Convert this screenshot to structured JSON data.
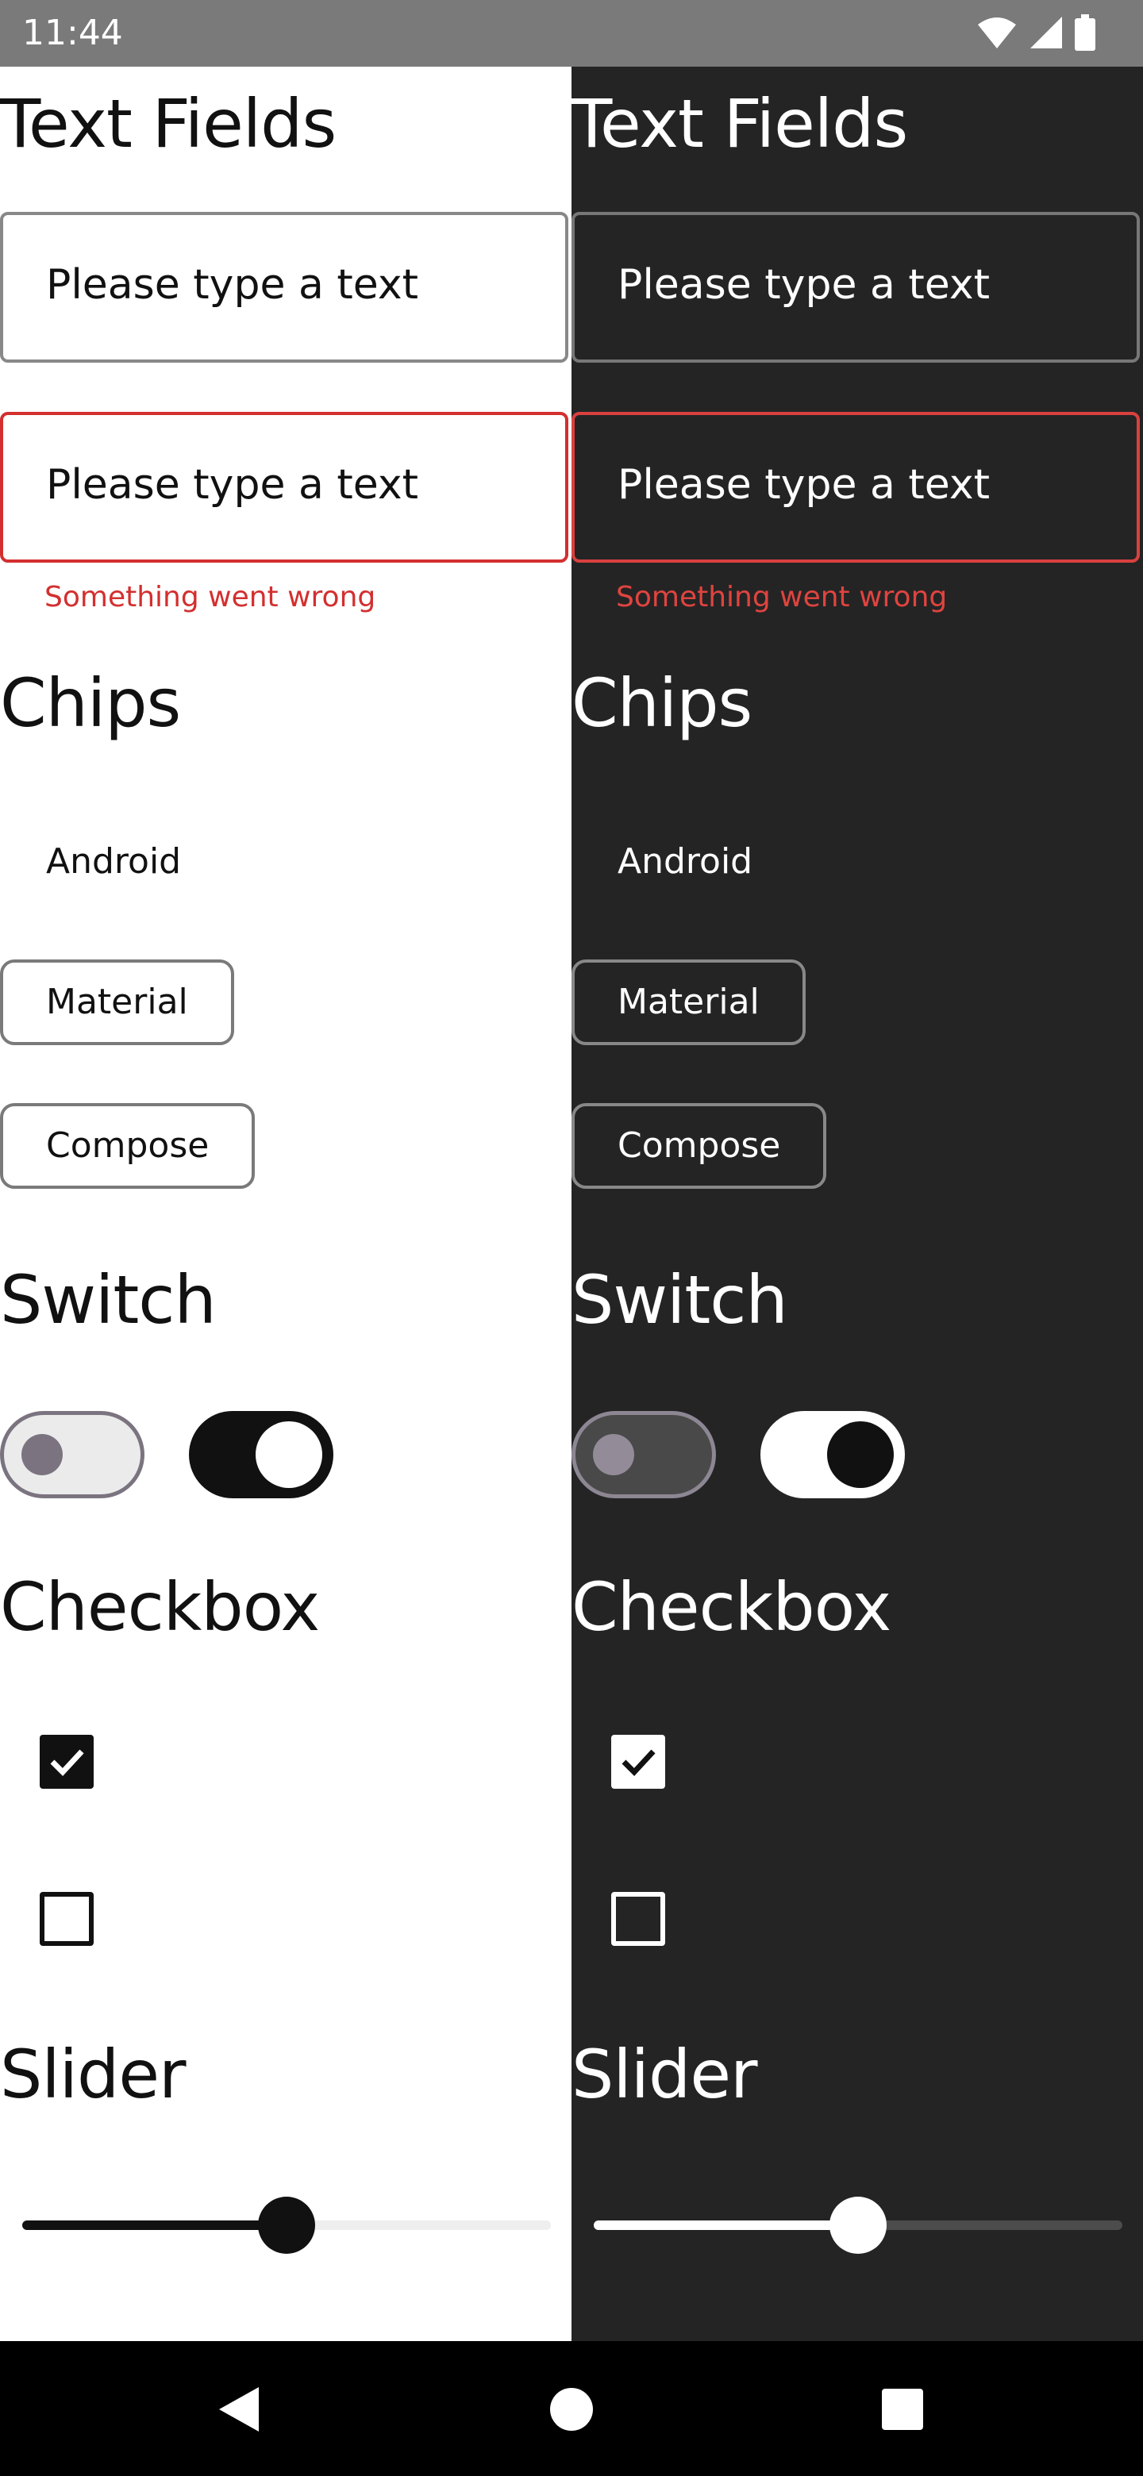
{
  "status_bar": {
    "time": "11:44",
    "icons": [
      "wifi-icon",
      "cell-signal-icon",
      "battery-icon"
    ]
  },
  "panels": {
    "light": {
      "text_fields_title": "Text Fields",
      "text_field_1": "Please type a text",
      "text_field_2": "Please type a text",
      "error_message": "Something went wrong",
      "chips_title": "Chips",
      "chips": [
        "Android",
        "Material",
        "Compose"
      ],
      "switch_title": "Switch",
      "switches": [
        false,
        true
      ],
      "checkbox_title": "Checkbox",
      "checkboxes": [
        true,
        false
      ],
      "slider_title": "Slider",
      "slider_value": 0.5
    },
    "dark": {
      "text_fields_title": "Text Fields",
      "text_field_1": "Please type a text",
      "text_field_2": "Please type a text",
      "error_message": "Something went wrong",
      "chips_title": "Chips",
      "chips": [
        "Android",
        "Material",
        "Compose"
      ],
      "switch_title": "Switch",
      "switches": [
        false,
        true
      ],
      "checkbox_title": "Checkbox",
      "checkboxes": [
        true,
        false
      ],
      "slider_title": "Slider",
      "slider_value": 0.5
    }
  },
  "colors": {
    "light_background": "#ffffff",
    "dark_background": "#252425",
    "error": "#d32f2f",
    "status_bar": "#7a7a7a",
    "nav_bar": "#000000"
  },
  "nav_bar": {
    "buttons": [
      "back-icon",
      "home-icon",
      "recents-icon"
    ]
  }
}
